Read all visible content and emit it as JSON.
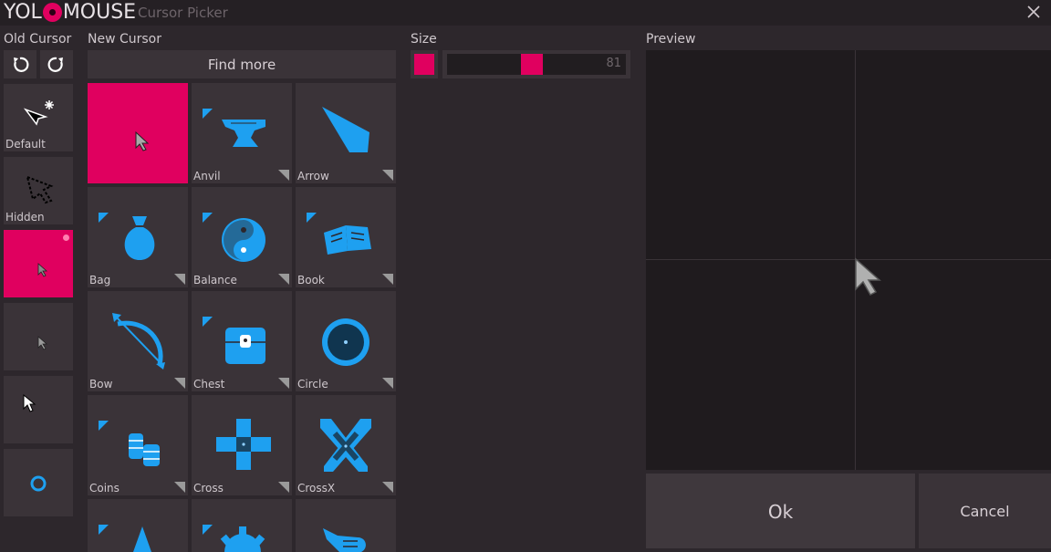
{
  "app": {
    "logo": "YOLOMOUSE",
    "title": "Cursor Picker"
  },
  "old_cursor": {
    "heading": "Old Cursor",
    "items": [
      {
        "label": "Default"
      },
      {
        "label": "Hidden"
      },
      {
        "label": ""
      },
      {
        "label": ""
      },
      {
        "label": ""
      },
      {
        "label": ""
      }
    ]
  },
  "new_cursor": {
    "heading": "New Cursor",
    "find_more": "Find more",
    "items": [
      {
        "label": ""
      },
      {
        "label": "Anvil"
      },
      {
        "label": "Arrow"
      },
      {
        "label": "Bag"
      },
      {
        "label": "Balance"
      },
      {
        "label": "Book"
      },
      {
        "label": "Bow"
      },
      {
        "label": "Chest"
      },
      {
        "label": "Circle"
      },
      {
        "label": "Coins"
      },
      {
        "label": "Cross"
      },
      {
        "label": "CrossX"
      }
    ]
  },
  "size": {
    "heading": "Size",
    "value": "81"
  },
  "preview": {
    "heading": "Preview"
  },
  "actions": {
    "ok": "Ok",
    "cancel": "Cancel"
  },
  "colors": {
    "accent": "#e0005f",
    "icon_blue": "#1ea0f0",
    "background": "#2d272c",
    "tile": "#3a3338"
  }
}
